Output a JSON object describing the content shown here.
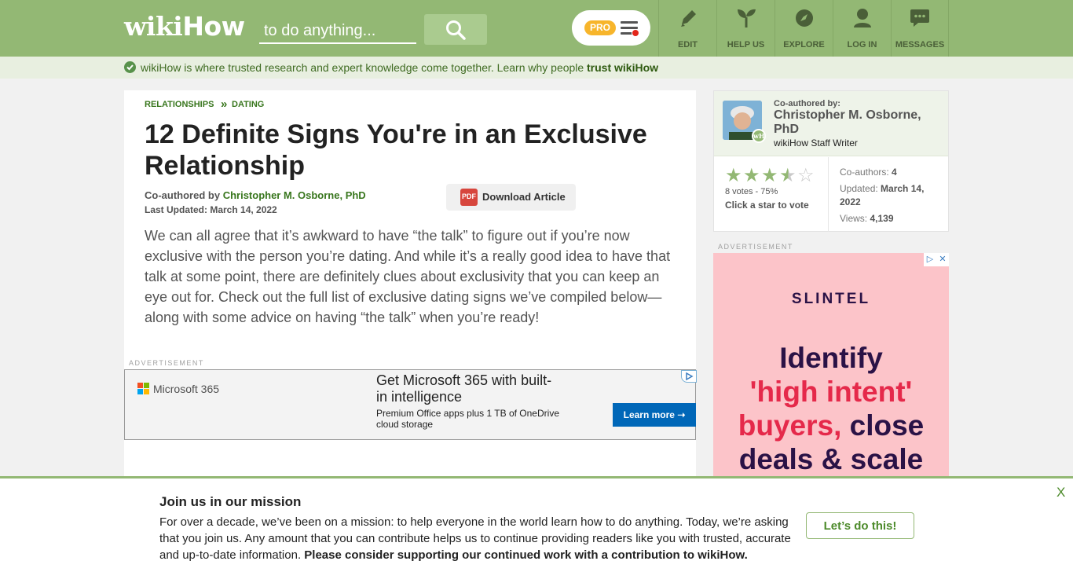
{
  "header": {
    "logo_wiki": "wiki",
    "logo_how": "How",
    "search_placeholder": "to do anything...",
    "pro_label": "PRO",
    "nav": [
      {
        "label": "EDIT",
        "icon": "pencil-icon"
      },
      {
        "label": "HELP US",
        "icon": "sprout-icon"
      },
      {
        "label": "EXPLORE",
        "icon": "compass-icon"
      },
      {
        "label": "LOG IN",
        "icon": "user-icon"
      },
      {
        "label": "MESSAGES",
        "icon": "chat-bubble-icon"
      }
    ]
  },
  "trust_bar": {
    "text": "wikiHow is where trusted research and expert knowledge come together. Learn why people",
    "link": "trust wikiHow"
  },
  "article": {
    "breadcrumbs": [
      "RELATIONSHIPS",
      "DATING"
    ],
    "breadcrumb_sep": "»",
    "title": "12 Definite Signs You're in an Exclusive Relationship",
    "coauthored_label": "Co-authored by",
    "author": "Christopher M. Osborne, PhD",
    "last_updated": "Last Updated: March 14, 2022",
    "download_label": "Download Article",
    "pdf_icon_text": "PDF",
    "intro": "We can all agree that it’s awkward to have “the talk” to figure out if you’re now exclusive with the person you’re dating. And while it’s a really good idea to have that talk at some point, there are definitely clues about exclusivity that you can keep an eye out for. Check out the full list of exclusive dating signs we’ve compiled below—along with some advice on having “the talk” when you’re ready!"
  },
  "ads": {
    "label": "ADVERTISEMENT",
    "microsoft": {
      "brand": "Microsoft 365",
      "headline": "Get Microsoft 365 with built-in intelligence",
      "subline": "Premium Office apps plus 1 TB of OneDrive cloud storage",
      "cta": "Learn more  ➝",
      "colors": [
        "#f25022",
        "#7fba00",
        "#00a4ef",
        "#ffb900"
      ]
    },
    "slintel": {
      "brand": "SLINTEL",
      "line1": "Identify",
      "line2": "'high intent'",
      "line3a": "buyers,",
      "line3b": " close",
      "line4": "deals & scale",
      "close": "✕",
      "choices": "▷"
    }
  },
  "sidebar": {
    "coauthored_label": "Co-authored by:",
    "author": "Christopher M. Osborne, PhD",
    "role": "wikiHow Staff Writer",
    "badge": "wH",
    "rating": {
      "percent": 75,
      "stars_filled": 3.5,
      "stars_total": 5,
      "votes_text": "8 votes - 75%",
      "cta": "Click a star to vote"
    },
    "stats": {
      "coauthors_label": "Co-authors:",
      "coauthors": "4",
      "updated_label": "Updated:",
      "updated": "March 14, 2022",
      "views_label": "Views:",
      "views": "4,139"
    }
  },
  "banner": {
    "title": "Join us in our mission",
    "text": "For over a decade, we’ve been on a mission: to help everyone in the world learn how to do anything. Today, we’re asking that you join us. Any amount that you can contribute helps us to continue providing readers like you with trusted, accurate and up-to-date information.",
    "text_bold": "Please consider supporting our continued work with a contribution to wikiHow.",
    "button": "Let’s do this!",
    "close": "X"
  },
  "colors": {
    "brand_green": "#93b874",
    "link_green": "#38761d",
    "pro_orange": "#f7b52b",
    "ms_blue": "#0067b8",
    "slintel_pink": "#fcc4c9",
    "slintel_red": "#e5294a"
  }
}
